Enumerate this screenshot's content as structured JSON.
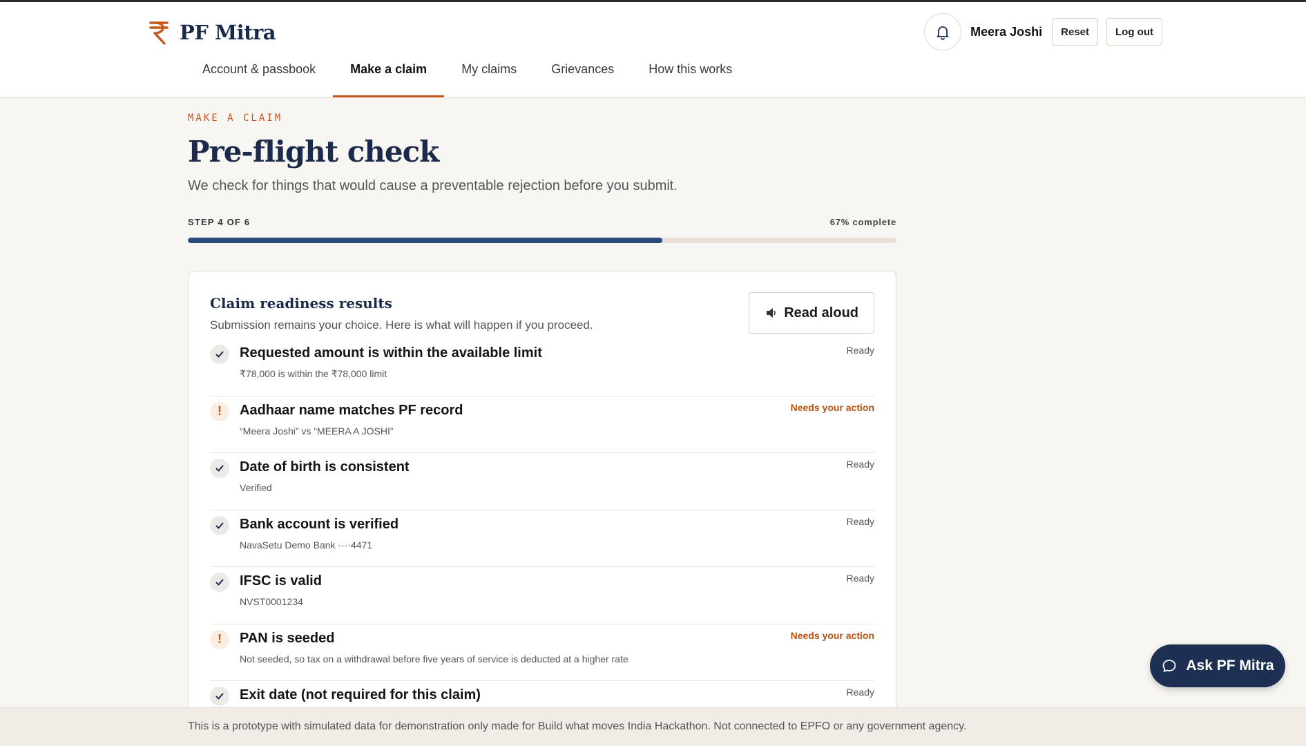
{
  "brand": {
    "name": "PF Mitra",
    "accent": "#c8561c",
    "navy": "#1b2a4a"
  },
  "user": {
    "name": "Meera Joshi",
    "reset_label": "Reset",
    "logout_label": "Log out"
  },
  "nav": {
    "items": [
      {
        "label": "Account & passbook",
        "active": false
      },
      {
        "label": "Make a claim",
        "active": true
      },
      {
        "label": "My claims",
        "active": false
      },
      {
        "label": "Grievances",
        "active": false
      },
      {
        "label": "How this works",
        "active": false
      }
    ]
  },
  "page": {
    "eyebrow": "MAKE A CLAIM",
    "title": "Pre-flight check",
    "subtitle": "We check for things that would cause a preventable rejection before you submit."
  },
  "progress": {
    "step_label": "STEP 4 OF 6",
    "percent_label": "67% complete",
    "fraction": 0.67
  },
  "card": {
    "title": "Claim readiness results",
    "subtitle": "Submission remains your choice. Here is what will happen if you proceed.",
    "read_aloud_label": "Read aloud",
    "checks": [
      {
        "title": "Requested amount is within the available limit",
        "detail": "₹78,000 is within the ₹78,000 limit",
        "status": "Ready",
        "state": "ok"
      },
      {
        "title": "Aadhaar name matches PF record",
        "detail": "“Meera Joshi” vs “MEERA A JOSHI”",
        "status": "Needs your action",
        "state": "warn"
      },
      {
        "title": "Date of birth is consistent",
        "detail": "Verified",
        "status": "Ready",
        "state": "ok"
      },
      {
        "title": "Bank account is verified",
        "detail": "NavaSetu Demo Bank ····4471",
        "status": "Ready",
        "state": "ok"
      },
      {
        "title": "IFSC is valid",
        "detail": "NVST0001234",
        "status": "Ready",
        "state": "ok"
      },
      {
        "title": "PAN is seeded",
        "detail": "Not seeded, so tax on a withdrawal before five years of service is deducted at a higher rate",
        "status": "Needs your action",
        "state": "warn"
      },
      {
        "title": "Exit date (not required for this claim)",
        "detail": "",
        "status": "Ready",
        "state": "ok"
      }
    ]
  },
  "chat": {
    "label": "Ask PF Mitra"
  },
  "footer": {
    "text": "This is a prototype with simulated data for demonstration only made for Build what moves India Hackathon. Not connected to EPFO or any government agency."
  }
}
